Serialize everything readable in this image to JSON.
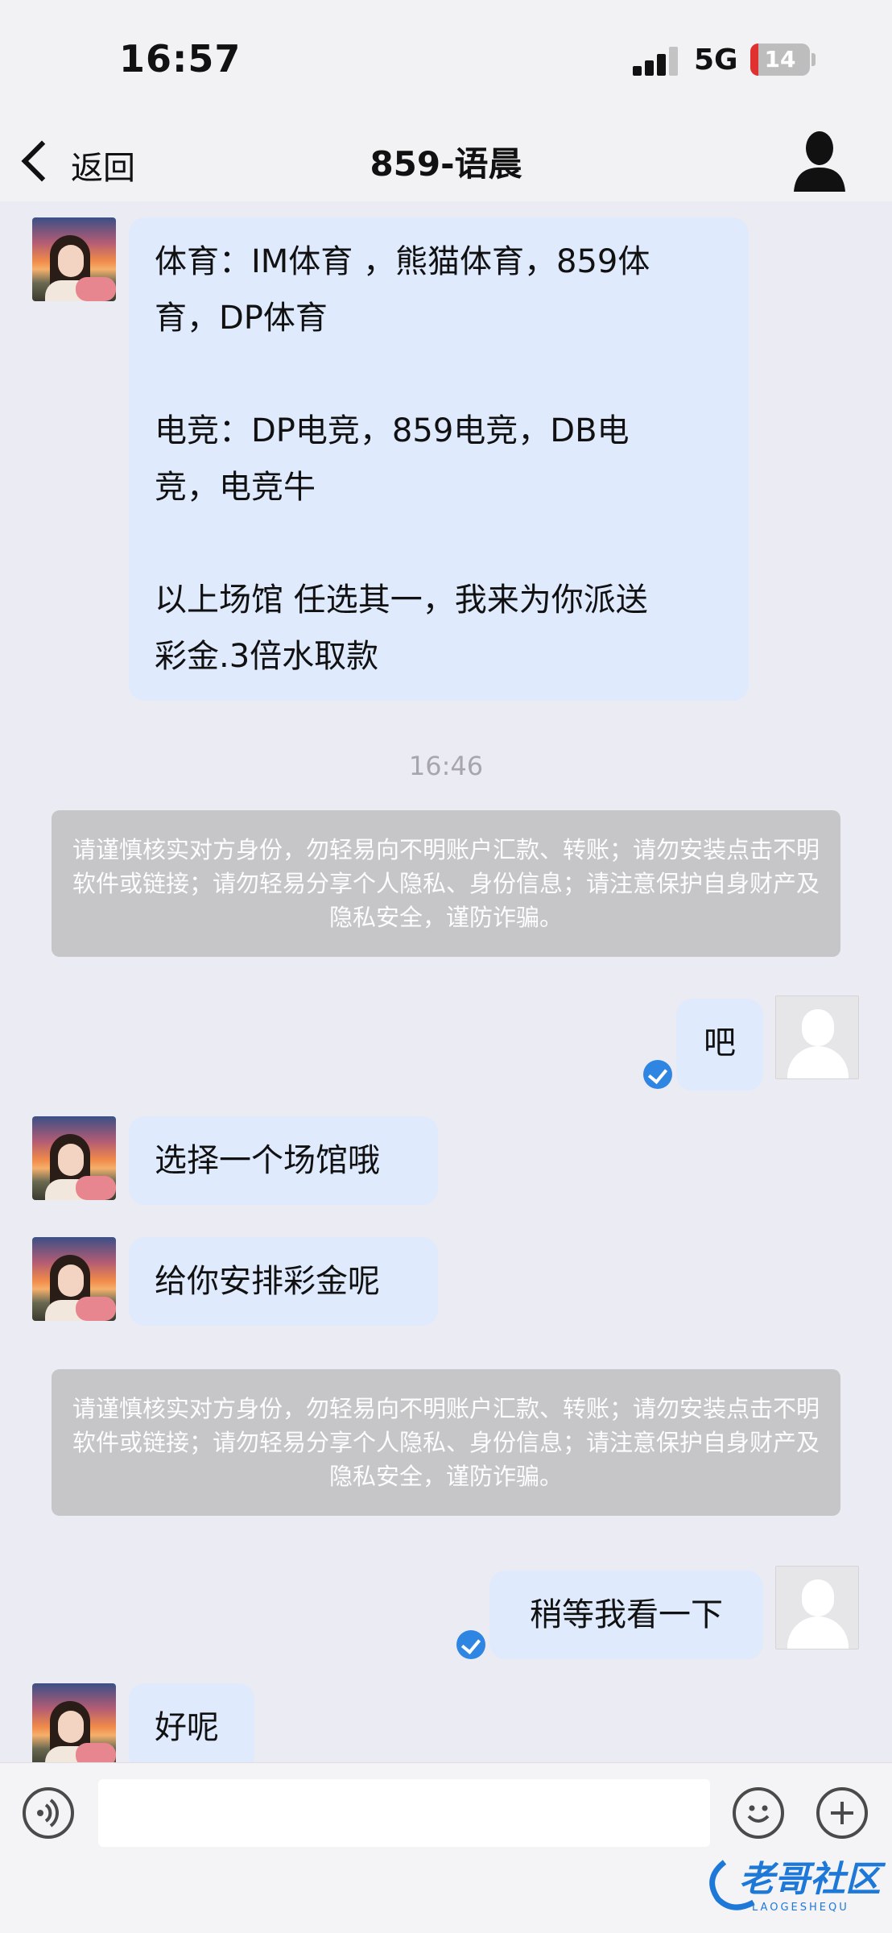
{
  "status_bar": {
    "time": "16:57",
    "network": "5G",
    "battery": "14",
    "battery_color": "#e03030"
  },
  "nav": {
    "back_label": "返回",
    "title": "859-语晨",
    "profile_icon": "person-icon"
  },
  "messages": {
    "m1": {
      "line1": "体育：IM体育 ，熊猫体育，859体",
      "line2": "育，DP体育",
      "line3": "电竞：DP电竞，859电竞，DB电",
      "line4": "竞，电竞牛",
      "line5": "以上场馆 任选其一，我来为你派送",
      "line6": "彩金.3倍水取款"
    },
    "timestamp": "16:46",
    "notice1": "请谨慎核实对方身份，勿轻易向不明账户汇款、转账；请勿安装点击不明软件或链接；请勿轻易分享个人隐私、身份信息；请注意保护自身财产及隐私安全，谨防诈骗。",
    "m2": "吧",
    "m3": "选择一个场馆哦",
    "m4": "给你安排彩金呢",
    "notice2": "请谨慎核实对方身份，勿轻易向不明账户汇款、转账；请勿安装点击不明软件或链接；请勿轻易分享个人隐私、身份信息；请注意保护自身财产及隐私安全，谨防诈骗。",
    "m5": "稍等我看一下",
    "m6": "好呢"
  },
  "input_bar": {
    "placeholder": "",
    "voice_icon": "voice-icon",
    "emoji_icon": "emoji-icon",
    "plus_icon": "plus-icon"
  },
  "watermark": {
    "text": "老哥社区",
    "subtext": "LAOGESHEQU",
    "color": "#1e78d8"
  },
  "colors": {
    "bubble": "#dfeafd",
    "background": "#ebebf4",
    "read_check": "#2f86e2"
  }
}
